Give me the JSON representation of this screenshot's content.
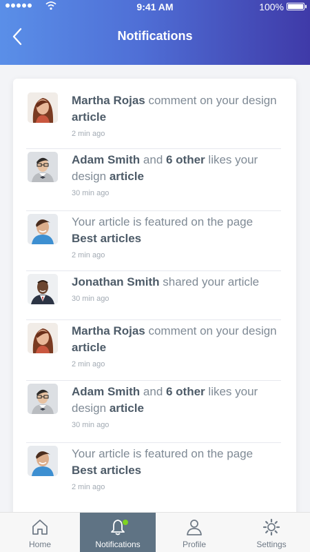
{
  "status_bar": {
    "time": "9:41 AM",
    "battery": "100%"
  },
  "header": {
    "title": "Notifications"
  },
  "notifications": [
    {
      "parts": [
        {
          "t": "Martha Rojas",
          "b": true
        },
        {
          "t": " comment on your design ",
          "b": false
        },
        {
          "t": "article",
          "b": true
        }
      ],
      "time": "2 min ago",
      "avatar": "woman-avatar"
    },
    {
      "parts": [
        {
          "t": "Adam Smith",
          "b": true
        },
        {
          "t": " and ",
          "b": false
        },
        {
          "t": "6 other",
          "b": true
        },
        {
          "t": " likes your design ",
          "b": false
        },
        {
          "t": "article",
          "b": true
        }
      ],
      "time": "30 min ago",
      "avatar": "man-glasses-avatar"
    },
    {
      "parts": [
        {
          "t": "Your article is featured on the page ",
          "b": false
        },
        {
          "t": "Best articles",
          "b": true
        }
      ],
      "time": "2 min ago",
      "avatar": "man-smiling-avatar"
    },
    {
      "parts": [
        {
          "t": "Jonathan Smith",
          "b": true
        },
        {
          "t": " shared your article",
          "b": false
        }
      ],
      "time": "30 min ago",
      "avatar": "man-suit-avatar"
    },
    {
      "parts": [
        {
          "t": "Martha Rojas",
          "b": true
        },
        {
          "t": " comment on your design ",
          "b": false
        },
        {
          "t": "article",
          "b": true
        }
      ],
      "time": "2 min ago",
      "avatar": "woman-avatar"
    },
    {
      "parts": [
        {
          "t": "Adam Smith",
          "b": true
        },
        {
          "t": " and ",
          "b": false
        },
        {
          "t": "6 other",
          "b": true
        },
        {
          "t": " likes your design ",
          "b": false
        },
        {
          "t": "article",
          "b": true
        }
      ],
      "time": "30 min ago",
      "avatar": "man-glasses-avatar"
    },
    {
      "parts": [
        {
          "t": "Your article is featured on the page ",
          "b": false
        },
        {
          "t": "Best articles",
          "b": true
        }
      ],
      "time": "2 min ago",
      "avatar": "man-smiling-avatar"
    }
  ],
  "tabs": [
    {
      "label": "Home",
      "icon": "home-icon",
      "active": false
    },
    {
      "label": "Notifications",
      "icon": "bell-icon",
      "active": true
    },
    {
      "label": "Profile",
      "icon": "person-icon",
      "active": false
    },
    {
      "label": "Settings",
      "icon": "gear-icon",
      "active": false
    }
  ],
  "colors": {
    "header_start": "#5a8fe8",
    "header_end": "#3f3aa8",
    "active_tab": "#5f7384",
    "badge": "#7ed321"
  }
}
